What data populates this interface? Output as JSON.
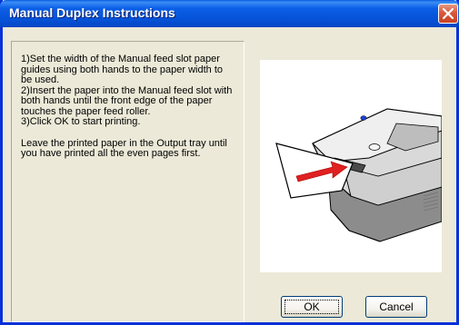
{
  "window": {
    "title": "Manual Duplex Instructions",
    "accent": "#0653d8",
    "close_color": "#d9583b"
  },
  "instructions": {
    "step1": "1)Set the width of the Manual feed slot paper guides using both hands to the paper width to be used.",
    "step2": "2)Insert the paper into the Manual feed slot with both hands until the front edge of the paper touches the paper feed roller.",
    "step3": "3)Click OK to start printing.",
    "note": "Leave the printed paper in the Output tray until you have printed all the even pages first."
  },
  "illustration": {
    "icon": "printer-manual-feed-illustration"
  },
  "buttons": {
    "ok_label": "OK",
    "cancel_label": "Cancel"
  }
}
